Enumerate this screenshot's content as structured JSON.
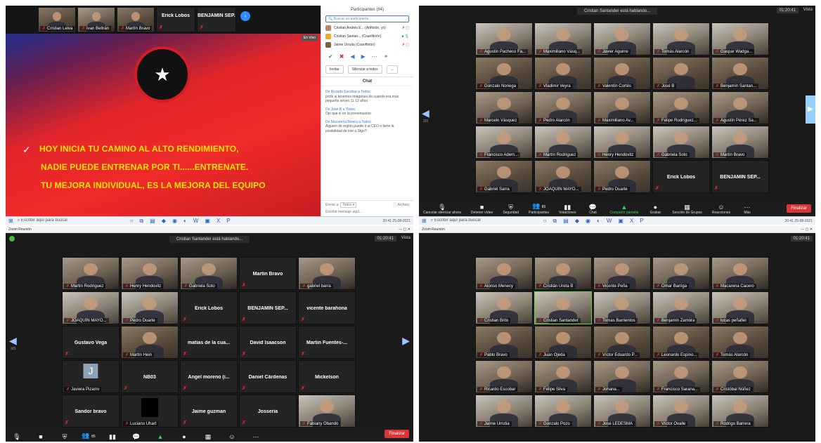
{
  "q1": {
    "top_strip": [
      {
        "name": "Cristian Leiva"
      },
      {
        "name": "Ivan Beltrán"
      },
      {
        "name": "Martín Bravo"
      }
    ],
    "top_names": [
      "Erick Lobos",
      "BENJAMIN SEP..."
    ],
    "slide": {
      "tag": "En Vivo",
      "line1": "HOY INICIA TU CAMINO AL ALTO RENDIMIENTO,",
      "line2": "NADIE PUEDE ENTRENAR POR TI......ENTRENATE.",
      "line3": "TU MEJORA INDIVIDUAL, ES LA MEJORA DEL EQUIPO"
    },
    "panel": {
      "title": "Participantes (84)",
      "search_placeholder": "Buscar un participante",
      "participants": [
        "Cristian Andrés E... (Anfitrión, yo)",
        "Cristian Santan... (Coanfitrión)",
        "Jaime Urrutia (Coanfitrión)"
      ],
      "invite": "Invitar",
      "mute_all": "Silenciar a todos",
      "more": "...",
      "chat_title": "Chat",
      "messages": [
        {
          "from": "De Ricardo Escobar a Todos:",
          "text": "profe si tenemos imágenes de cuando era más pequeño sirven 11 12 años"
        },
        {
          "from": "De José B a Todos:",
          "text": "Ojo que si en la presentación"
        },
        {
          "from": "De Macarena Rivera a Todos:",
          "text": "Alguien de región puede ir al CEO o tiene la posibilidad de irse a Stgo?"
        }
      ],
      "send_to": "Enviar a:",
      "send_target": "Todos ▾",
      "file": "Archivo",
      "compose_placeholder": "Escribir mensaje aquí..."
    }
  },
  "q2": {
    "banner": "Cristian Santander está hablando...",
    "clock": "01:20:41",
    "view": "Vista",
    "page": "2/3",
    "rows": [
      [
        "Agustín Pacheco Fa...",
        "Maximiliano Vásq...",
        "Javier Aguirre",
        "Tomás Alarcón",
        "Gaspar Wadga..."
      ],
      [
        "Gonzalo Noriega",
        "Vladimir Veyra",
        "Valentín Cortés",
        "José B",
        "Benjamín Santan..."
      ],
      [
        "Marcelo Vásquez",
        "Pedro Alarcón",
        "Maximiliano Av...",
        "Felipe Rodríguez...",
        "Agustín Pérez Sa..."
      ],
      [
        "Francisco Adem...",
        "Martín Rodríguez",
        "Henry Hendovitz",
        "Gabriela Soto",
        "Martín Bravo"
      ],
      [
        "Gabriel Sarra",
        "JOAQUÍN MAYO...",
        "Pedro Duarte",
        "Erick Lobos",
        "BENJAMIN SEP..."
      ]
    ],
    "toolbar": [
      "Cancelar silenciar ahora",
      "Detener vídeo",
      "Seguridad",
      "Participantes",
      "Votaciones",
      "Chat",
      "Compartir pantalla",
      "Grabar",
      "Sección de Grupos",
      "Reacciones",
      "Más"
    ],
    "participants_count": "85",
    "end": "Finalizar"
  },
  "taskbar_left": {
    "search": "Escribir aquí para buscar",
    "time": "20:41",
    "date": "25-08-2021"
  },
  "taskbar_right": {
    "search": "Escribir aquí para buscar",
    "time": "20:41",
    "date": "25-08-2021"
  },
  "q3": {
    "title": "Zoom Reunión",
    "banner": "Cristian Santander está hablando...",
    "clock": "01:20:41",
    "view": "Vista",
    "page": "3/3",
    "rows": [
      [
        {
          "n": "Martín Rodríguez",
          "v": 1
        },
        {
          "n": "Henry Hendovitz",
          "v": 1
        },
        {
          "n": "Gabriela Soto",
          "v": 1
        },
        {
          "n": "Martín Bravo",
          "v": 0
        },
        {
          "n": "gabriel barra",
          "v": 1
        }
      ],
      [
        {
          "n": "JOAQUÍN MAYO...",
          "v": 1
        },
        {
          "n": "Pedro Duarte",
          "v": 1
        },
        {
          "n": "Erick Lobos",
          "v": 0
        },
        {
          "n": "BENJAMIN SEP...",
          "v": 0
        },
        {
          "n": "vicente barahona",
          "v": 0
        }
      ],
      [
        {
          "n": "Gustavo Vega",
          "v": 0
        },
        {
          "n": "Martín Hein",
          "v": 1
        },
        {
          "n": "matias de la cua...",
          "v": 0
        },
        {
          "n": "David Isaacson",
          "v": 0
        },
        {
          "n": "Martin Fuentes-...",
          "v": 0
        }
      ],
      [
        {
          "n": "Javiera Pizarro",
          "v": 2
        },
        {
          "n": "NB03",
          "v": 0
        },
        {
          "n": "Ángel moreno (i...",
          "v": 0
        },
        {
          "n": "Daniel Cárdenas",
          "v": 0
        },
        {
          "n": "Mickelson",
          "v": 0
        }
      ],
      [
        {
          "n": "Sandor bravo",
          "v": 0
        },
        {
          "n": "Luciano Uhart",
          "v": 3
        },
        {
          "n": "Jaime guzman",
          "v": 0
        },
        {
          "n": "Josseria",
          "v": 0
        },
        {
          "n": "Fabiany Obando",
          "v": 1
        }
      ]
    ],
    "avatar_letter": "J",
    "participants_count": "85",
    "end": "Finalizar"
  },
  "q4": {
    "title": "Zoom Reunión",
    "clock": "01:20:41",
    "rows": [
      [
        "Alonso Menecy",
        "Cristián Ureta B",
        "Vicente Peña",
        "Omar Barriga",
        "Macarena Cacero"
      ],
      [
        "Cristian Brito",
        "Cristian Santander",
        "Tomas Barrientos",
        "Benjamin Zamora",
        "lucas peñafiel"
      ],
      [
        "Pablo Bravo",
        "Juan Ojeda",
        "Víctor Eduardo P...",
        "Leonardo Espino...",
        "Tomás Alarcón"
      ],
      [
        "Ricardo Escobar",
        "Felipe Silva",
        "Johana...",
        "Francisco Sarana...",
        "Cristóbal Núñez"
      ],
      [
        "Jaime Urrutia",
        "Gonzalo Pozo",
        "José LEDESMA",
        "Víctor Ovalle",
        "Rodrigo Barrera"
      ]
    ]
  }
}
